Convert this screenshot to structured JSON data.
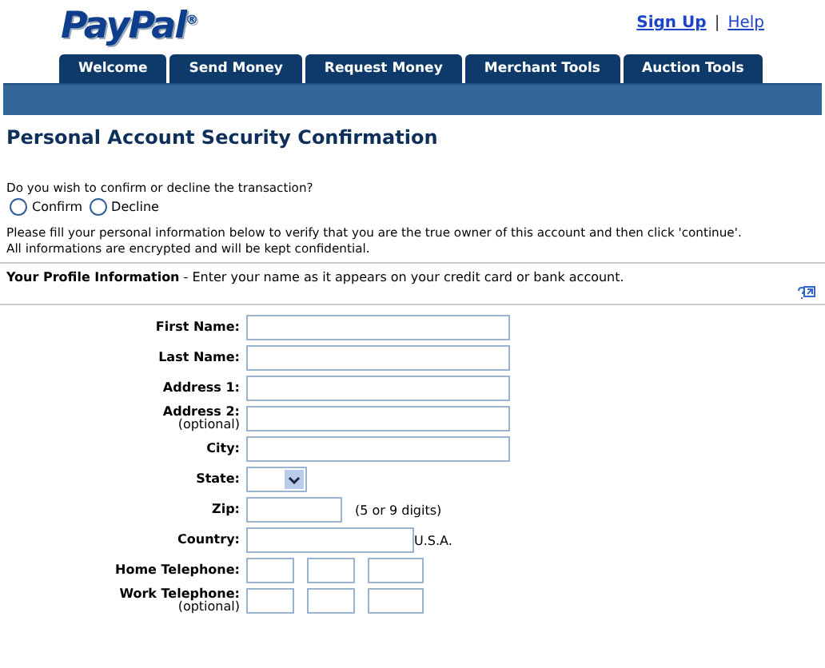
{
  "header": {
    "logo": "PayPal",
    "logo_mark": "®",
    "links": [
      "Sign Up",
      "Help"
    ],
    "separator": "|"
  },
  "tabs": [
    {
      "label": "Welcome",
      "selected": false
    },
    {
      "label": "Send Money",
      "selected": false
    },
    {
      "label": "Request Money",
      "selected": false
    },
    {
      "label": "Merchant Tools",
      "selected": false
    },
    {
      "label": "Auction Tools",
      "selected": false
    }
  ],
  "title": "Personal Account Security Confirmation",
  "question": "Do you wish to confirm or decline the transaction?",
  "choices": [
    {
      "label": "Confirm",
      "selected": false
    },
    {
      "label": "Decline",
      "selected": false
    }
  ],
  "instructions": [
    "Please fill your personal information below to verify that you are the true owner of this account and then click 'continue'.",
    "All informations are encrypted and will be kept confidential."
  ],
  "section": {
    "title": "Your Profile Information",
    "text": " - Enter your name as it appears on your credit card or bank account."
  },
  "fields": [
    {
      "kind": "text",
      "label": "First Name:"
    },
    {
      "kind": "text",
      "label": "Last Name:"
    },
    {
      "kind": "text",
      "label": "Address 1:"
    },
    {
      "kind": "text",
      "label": "Address 2:",
      "note": "(optional)"
    },
    {
      "kind": "text",
      "label": "City:"
    },
    {
      "kind": "select",
      "label": "State:"
    },
    {
      "kind": "zip",
      "label": "Zip:",
      "hint": "(5 or 9 digits)"
    },
    {
      "kind": "country",
      "label": "Country:",
      "suffix": "U.S.A."
    },
    {
      "kind": "phone",
      "label": "Home Telephone:"
    },
    {
      "kind": "phone",
      "label": "Work Telephone:",
      "note": "(optional)"
    }
  ]
}
